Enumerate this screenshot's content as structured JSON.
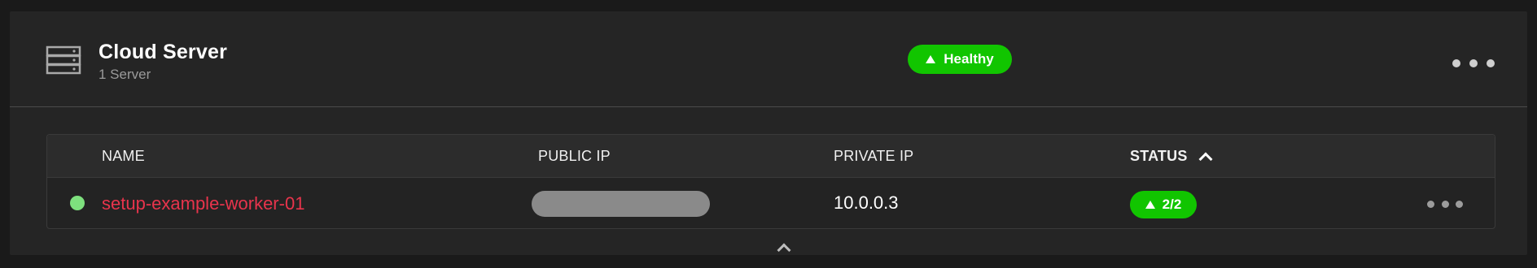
{
  "card": {
    "title": "Cloud Server",
    "subtitle": "1 Server",
    "icon": "server-stack-icon",
    "health_label": "Healthy",
    "health_color": "#11c500"
  },
  "table": {
    "columns": [
      "NAME",
      "PUBLIC IP",
      "PRIVATE IP",
      "STATUS"
    ],
    "sorted_column": "STATUS",
    "sort_direction": "ascending",
    "rows": [
      {
        "name": "setup-example-worker-01",
        "public_ip": "",
        "private_ip": "10.0.0.3",
        "status": "2/2",
        "indicator_color": "#7ee07e"
      }
    ]
  },
  "colors": {
    "background": "#1a1a1a",
    "card": "#252525",
    "accent_green": "#11c500",
    "link_red": "#e8344c"
  }
}
